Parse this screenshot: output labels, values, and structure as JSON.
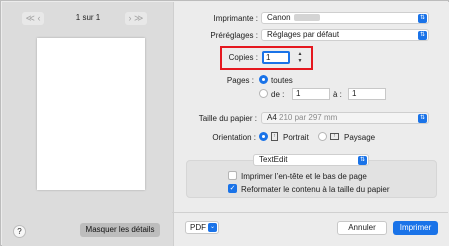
{
  "preview": {
    "prev_icon": "double-chevron-left-icon",
    "prev_label": "≪ ‹",
    "page_indicator": "1 sur 1",
    "next_label": "› ≫",
    "next_icon": "double-chevron-right-icon"
  },
  "left_footer": {
    "help_label": "?",
    "hide_details_label": "Masquer les détails"
  },
  "printer": {
    "label": "Imprimante :",
    "value": "Canon"
  },
  "presets": {
    "label": "Préréglages :",
    "value": "Réglages par défaut"
  },
  "copies": {
    "label": "Copies :",
    "value": "1",
    "stepper_icon": "stepper-icon"
  },
  "pages": {
    "label": "Pages :",
    "all_label": "toutes",
    "from_label": "de :",
    "from_value": "1",
    "to_label": "à :",
    "to_value": "1",
    "selected": "all"
  },
  "paper_size": {
    "label": "Taille du papier :",
    "value": "A4",
    "detail": "210 par 297 mm"
  },
  "orientation": {
    "label": "Orientation :",
    "portrait_label": "Portrait",
    "landscape_label": "Paysage",
    "selected": "portrait"
  },
  "app_section": {
    "app_select": "TextEdit",
    "header_footer_label": "Imprimer l’en-tête et le bas de page",
    "header_footer_checked": false,
    "fit_label": "Reformater le contenu à la taille du papier",
    "fit_checked": true
  },
  "footer": {
    "pdf_label": "PDF",
    "cancel_label": "Annuler",
    "print_label": "Imprimer"
  },
  "colors": {
    "accent": "#1a73e8",
    "highlight": "#e5181f"
  }
}
